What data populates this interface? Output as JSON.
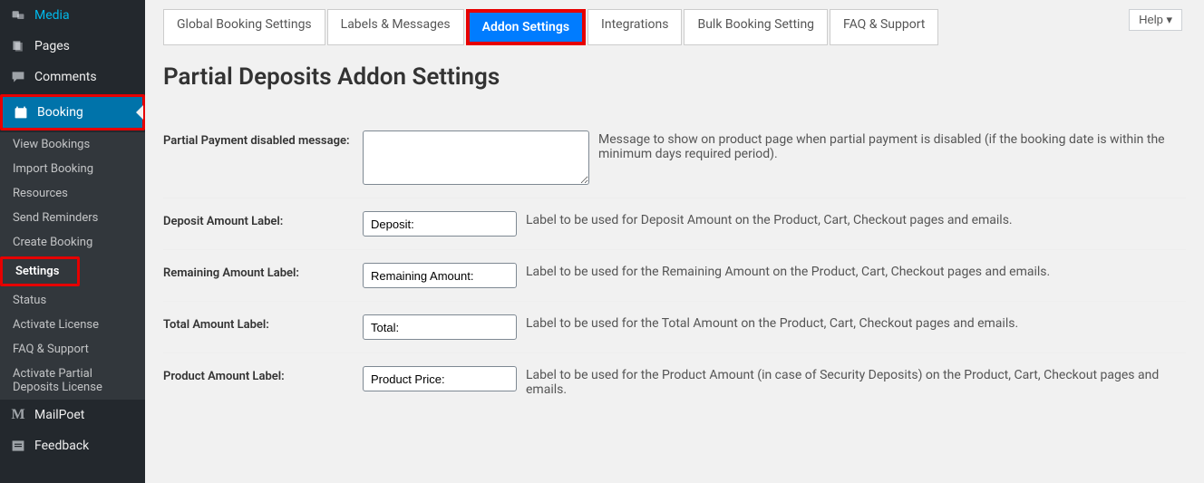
{
  "sidebar": {
    "media": "Media",
    "pages": "Pages",
    "comments": "Comments",
    "booking": "Booking",
    "submenu": {
      "view_bookings": "View Bookings",
      "import_booking": "Import Booking",
      "resources": "Resources",
      "send_reminders": "Send Reminders",
      "create_booking": "Create Booking",
      "settings": "Settings",
      "status": "Status",
      "activate_license": "Activate License",
      "faq_support": "FAQ & Support",
      "activate_partial": "Activate Partial Deposits License"
    },
    "mailpoet": "MailPoet",
    "feedback": "Feedback"
  },
  "help_label": "Help ▾",
  "tabs": {
    "global": "Global Booking Settings",
    "labels": "Labels & Messages",
    "addon": "Addon Settings",
    "integrations": "Integrations",
    "bulk": "Bulk Booking Setting",
    "faq": "FAQ & Support"
  },
  "page_title": "Partial Deposits Addon Settings",
  "fields": {
    "disabled_msg": {
      "label": "Partial Payment disabled message:",
      "value": "",
      "desc": "Message to show on product page when partial payment is disabled (if the booking date is within the minimum days required period)."
    },
    "deposit": {
      "label": "Deposit Amount Label:",
      "value": "Deposit:",
      "desc": "Label to be used for Deposit Amount on the Product, Cart, Checkout pages and emails."
    },
    "remaining": {
      "label": "Remaining Amount Label:",
      "value": "Remaining Amount:",
      "desc": "Label to be used for the Remaining Amount on the Product, Cart, Checkout pages and emails."
    },
    "total": {
      "label": "Total Amount Label:",
      "value": "Total:",
      "desc": "Label to be used for the Total Amount on the Product, Cart, Checkout pages and emails."
    },
    "product": {
      "label": "Product Amount Label:",
      "value": "Product Price:",
      "desc": "Label to be used for the Product Amount (in case of Security Deposits) on the Product, Cart, Checkout pages and emails."
    }
  }
}
